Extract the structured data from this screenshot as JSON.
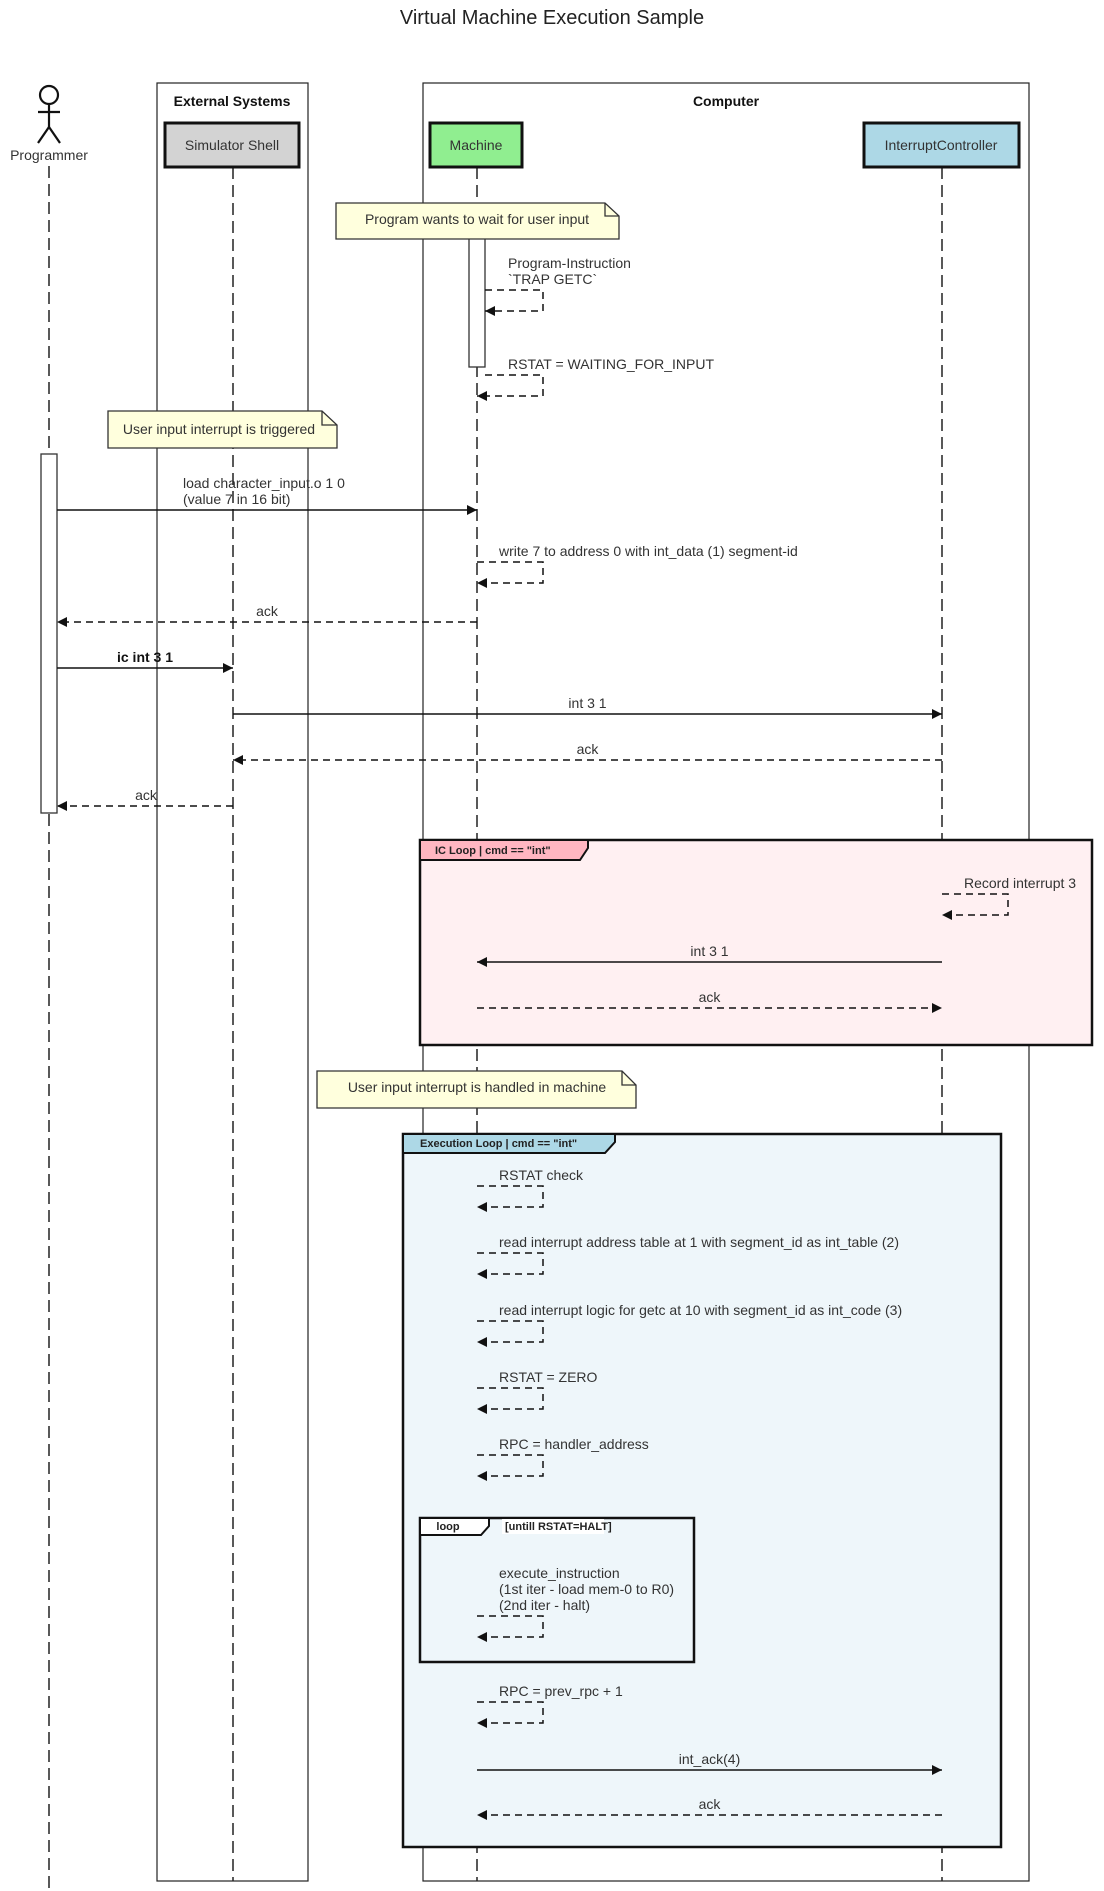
{
  "title": "Virtual Machine Execution Sample",
  "colors": {
    "simulator_shell": "#d3d3d3",
    "machine": "#90ee90",
    "interrupt_controller": "#add8e6",
    "note_fill": "#ffffdd",
    "ic_loop_fill": "#fff0f2",
    "ic_loop_tab": "#ffb6c1",
    "exec_loop_fill": "#eef6fa",
    "exec_loop_tab": "#add8e6"
  },
  "groups": [
    {
      "id": "external",
      "label": "External Systems"
    },
    {
      "id": "computer",
      "label": "Computer"
    }
  ],
  "participants": [
    {
      "id": "programmer",
      "label": "Programmer",
      "type": "actor"
    },
    {
      "id": "shell",
      "label": "Simulator Shell",
      "type": "box"
    },
    {
      "id": "machine",
      "label": "Machine",
      "type": "box"
    },
    {
      "id": "ic",
      "label": "InterruptController",
      "type": "box"
    }
  ],
  "notes": [
    {
      "id": "note1",
      "text": "Program wants to wait for user input"
    },
    {
      "id": "note2",
      "text": "User input interrupt is triggered"
    },
    {
      "id": "note3",
      "text": "User input interrupt is handled in machine"
    }
  ],
  "frames": [
    {
      "id": "ic_loop",
      "label": "IC Loop | cmd == \"int\"",
      "guard": ""
    },
    {
      "id": "exec_loop",
      "label": "Execution Loop | cmd == \"int\"",
      "guard": ""
    },
    {
      "id": "inner_loop",
      "label": "loop",
      "guard": "[untill RSTAT=HALT]"
    }
  ],
  "messages": [
    {
      "from": "machine",
      "to": "machine",
      "lines": [
        "Program-Instruction",
        "`TRAP GETC`"
      ],
      "style": "dashed"
    },
    {
      "from": "machine",
      "to": "machine",
      "lines": [
        "RSTAT = WAITING_FOR_INPUT"
      ],
      "style": "dashed"
    },
    {
      "from": "programmer",
      "to": "machine",
      "lines": [
        "load character_input.o 1 0",
        "(value 7 in 16 bit)"
      ],
      "style": "solid"
    },
    {
      "from": "machine",
      "to": "machine",
      "lines": [
        "write 7 to address 0 with int_data (1) segment-id"
      ],
      "style": "dashed"
    },
    {
      "from": "machine",
      "to": "programmer",
      "lines": [
        "ack"
      ],
      "style": "dashed"
    },
    {
      "from": "programmer",
      "to": "shell",
      "lines": [
        "ic int 3 1"
      ],
      "style": "solid",
      "bold": true
    },
    {
      "from": "shell",
      "to": "ic",
      "lines": [
        "int 3 1"
      ],
      "style": "solid"
    },
    {
      "from": "ic",
      "to": "shell",
      "lines": [
        "ack"
      ],
      "style": "dashed"
    },
    {
      "from": "shell",
      "to": "programmer",
      "lines": [
        "ack"
      ],
      "style": "dashed"
    },
    {
      "from": "ic",
      "to": "ic",
      "lines": [
        "Record interrupt 3"
      ],
      "style": "dashed"
    },
    {
      "from": "ic",
      "to": "machine",
      "lines": [
        "int 3 1"
      ],
      "style": "solid"
    },
    {
      "from": "machine",
      "to": "ic",
      "lines": [
        "ack"
      ],
      "style": "dashed"
    },
    {
      "from": "machine",
      "to": "machine",
      "lines": [
        "RSTAT check"
      ],
      "style": "dashed"
    },
    {
      "from": "machine",
      "to": "machine",
      "lines": [
        "read interrupt address table at 1 with segment_id as int_table (2)"
      ],
      "style": "dashed"
    },
    {
      "from": "machine",
      "to": "machine",
      "lines": [
        "read interrupt logic for getc at 10 with segment_id as int_code (3)"
      ],
      "style": "dashed"
    },
    {
      "from": "machine",
      "to": "machine",
      "lines": [
        "RSTAT = ZERO"
      ],
      "style": "dashed"
    },
    {
      "from": "machine",
      "to": "machine",
      "lines": [
        "RPC = handler_address"
      ],
      "style": "dashed"
    },
    {
      "from": "machine",
      "to": "machine",
      "lines": [
        "execute_instruction",
        "(1st iter - load mem-0 to R0)",
        "(2nd iter - halt)"
      ],
      "style": "dashed"
    },
    {
      "from": "machine",
      "to": "machine",
      "lines": [
        "RPC = prev_rpc + 1"
      ],
      "style": "dashed"
    },
    {
      "from": "machine",
      "to": "ic",
      "lines": [
        "int_ack(4)"
      ],
      "style": "solid"
    },
    {
      "from": "ic",
      "to": "machine",
      "lines": [
        "ack"
      ],
      "style": "dashed"
    }
  ]
}
